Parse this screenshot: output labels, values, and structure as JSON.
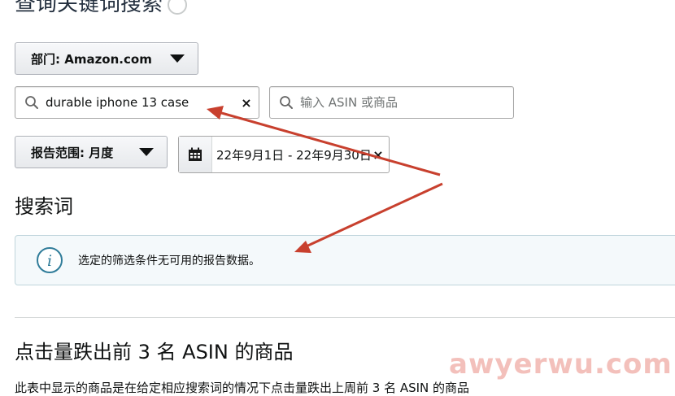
{
  "header": {
    "title": "查询关键词搜索"
  },
  "filters": {
    "department": {
      "label": "部门: Amazon.com"
    },
    "keyword_search": {
      "value": "durable iphone 13 case",
      "clear": "×"
    },
    "asin_search": {
      "placeholder": "输入 ASIN 或商品"
    },
    "report_range": {
      "label": "报告范围: 月度"
    },
    "date_range": {
      "value": "22年9月1日 - 22年9月30日",
      "clear": "×"
    }
  },
  "search_terms_section": {
    "heading": "搜索词",
    "alert": {
      "message": "选定的筛选条件无可用的报告数据。",
      "icon": "info-circle-icon"
    }
  },
  "top_asin_section": {
    "heading": "点击量跌出前 3 名 ASIN 的商品",
    "description": "此表中显示的商品是在给定相应搜索词的情况下点击量跌出上周前 3 名 ASIN 的商品"
  },
  "annotations": {
    "arrow_color": "#c8402e"
  },
  "watermark": {
    "text": "awyerwu.com",
    "color": "#f1b6b0"
  }
}
